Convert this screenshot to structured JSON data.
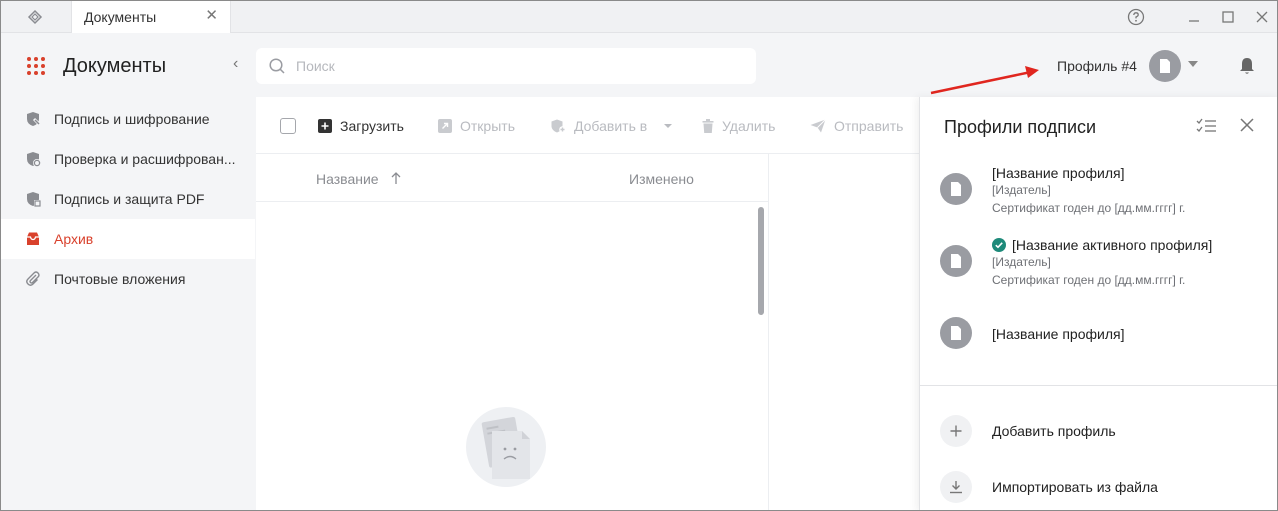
{
  "window": {
    "tab_title": "Документы",
    "tab_close": "✕",
    "help": "?",
    "minimize": "—",
    "maximize": "☐",
    "close": "✕"
  },
  "header": {
    "title": "Документы",
    "collapse": "‹",
    "search_placeholder": "Поиск",
    "search_value": "",
    "profile_label": "Профиль #4"
  },
  "sidebar": {
    "items": [
      {
        "label": "Подпись и шифрование",
        "icon": "shield-sign-icon",
        "active": false
      },
      {
        "label": "Проверка и расшифрован...",
        "icon": "shield-check-icon",
        "active": false
      },
      {
        "label": "Подпись и защита PDF",
        "icon": "shield-pdf-icon",
        "active": false
      },
      {
        "label": "Архив",
        "icon": "archive-icon",
        "active": true
      },
      {
        "label": "Почтовые вложения",
        "icon": "paperclip-icon",
        "active": false
      }
    ]
  },
  "toolbar": {
    "upload": "Загрузить",
    "open": "Открыть",
    "add_to": "Добавить в",
    "delete": "Удалить",
    "send": "Отправить"
  },
  "list": {
    "col_name": "Название",
    "col_modified": "Изменено"
  },
  "panel": {
    "title": "Профили подписи",
    "profiles": [
      {
        "name": "[Название профиля]",
        "issuer": "[Издатель]",
        "cert": "Сертификат годен до [дд.мм.гггг] г.",
        "active": false
      },
      {
        "name": "[Название активного профиля]",
        "issuer": "[Издатель]",
        "cert": "Сертификат годен до [дд.мм.гггг] г.",
        "active": true
      },
      {
        "name": "[Название профиля]",
        "active": false
      }
    ],
    "add_profile": "Добавить профиль",
    "import_file": "Импортировать из файла"
  },
  "colors": {
    "accent": "#d9412c",
    "active_check": "#1e8a7a",
    "annotation_arrow": "#e0261f"
  }
}
